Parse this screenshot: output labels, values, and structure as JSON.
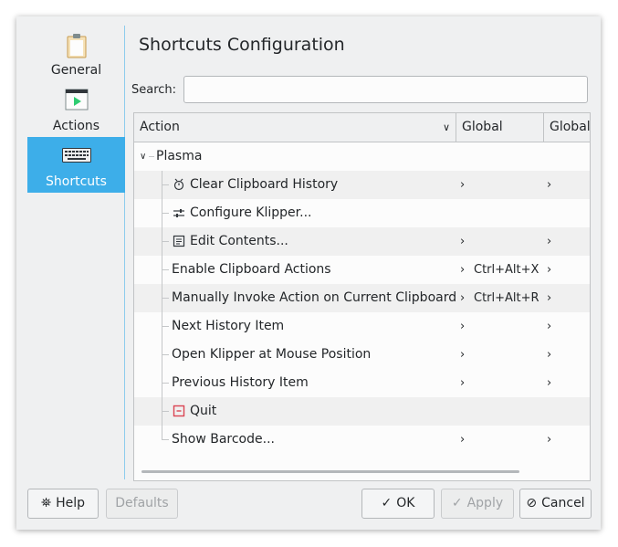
{
  "sidebar": {
    "items": [
      {
        "label": "General",
        "icon": "clipboard-icon"
      },
      {
        "label": "Actions",
        "icon": "play-icon"
      },
      {
        "label": "Shortcuts",
        "icon": "keyboard-icon"
      }
    ],
    "selected": "Shortcuts"
  },
  "page": {
    "title": "Shortcuts Configuration",
    "search_label": "Search:",
    "search_value": ""
  },
  "table": {
    "headers": [
      "Action",
      "Global",
      "Global"
    ],
    "group": "Plasma",
    "rows": [
      {
        "name": "Clear Clipboard History",
        "icon": "clear-history-icon",
        "shortcut": ""
      },
      {
        "name": "Configure Klipper...",
        "icon": "configure-icon",
        "shortcut": ""
      },
      {
        "name": "Edit Contents...",
        "icon": "edit-contents-icon",
        "shortcut": ""
      },
      {
        "name": "Enable Clipboard Actions",
        "icon": "",
        "shortcut": "Ctrl+Alt+X"
      },
      {
        "name": "Manually Invoke Action on Current Clipboard",
        "icon": "",
        "shortcut": "Ctrl+Alt+R"
      },
      {
        "name": "Next History Item",
        "icon": "",
        "shortcut": ""
      },
      {
        "name": "Open Klipper at Mouse Position",
        "icon": "",
        "shortcut": ""
      },
      {
        "name": "Previous History Item",
        "icon": "",
        "shortcut": ""
      },
      {
        "name": "Quit",
        "icon": "quit-icon",
        "shortcut": ""
      },
      {
        "name": "Show Barcode...",
        "icon": "",
        "shortcut": ""
      }
    ]
  },
  "buttons": {
    "help": "Help",
    "defaults": "Defaults",
    "ok": "OK",
    "apply": "Apply",
    "cancel": "Cancel"
  },
  "colors": {
    "accent": "#3daee9",
    "window_bg": "#eff0f1",
    "quit_icon": "#da4453"
  }
}
